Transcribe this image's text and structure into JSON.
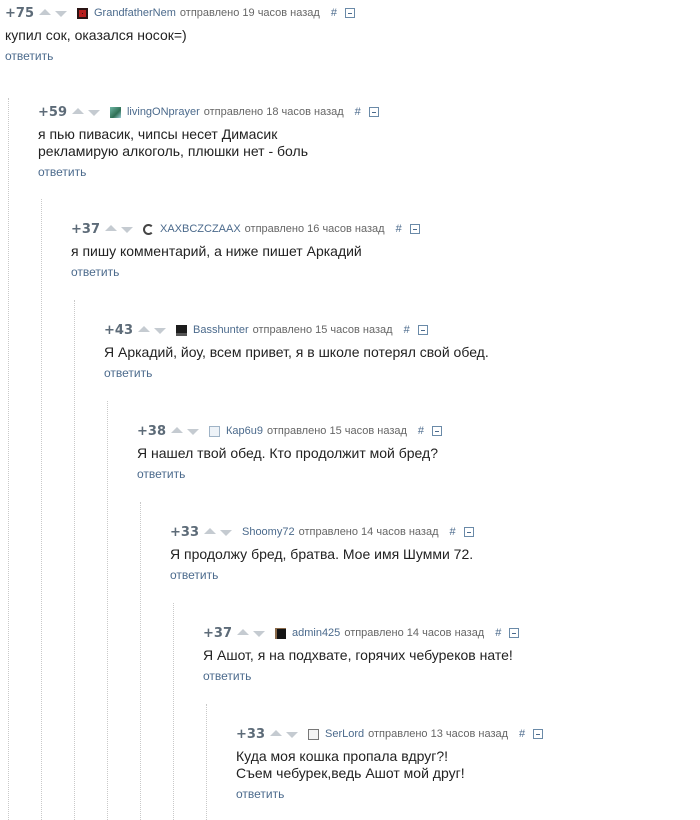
{
  "comments": [
    {
      "score": "+75",
      "author": "GrandfatherNem",
      "time": "отправлено 19 часов назад",
      "hash": "#",
      "text": "купил сок, оказался носок=)",
      "reply": "ответить",
      "avatar": "dark-red-figure-icon"
    },
    {
      "score": "+59",
      "author": "livingONprayer",
      "time": "отправлено 18 часов назад",
      "hash": "#",
      "text": "я пью пивасик, чипсы несет Димасик\nрекламирую алкоголь, плюшки нет - боль",
      "reply": "ответить",
      "avatar": "landscape-photo-icon"
    },
    {
      "score": "+37",
      "author": "XAXBCZCZAAX",
      "time": "отправлено 16 часов назад",
      "hash": "#",
      "text": "я пишу комментарий, а ниже пишет Аркадий",
      "reply": "ответить",
      "avatar": "swirl-icon"
    },
    {
      "score": "+43",
      "author": "Basshunter",
      "time": "отправлено 15 часов назад",
      "hash": "#",
      "text": "Я Аркадий, йоу, всем привет, я в школе потерял свой обед.",
      "reply": "ответить",
      "avatar": "dark-logo-icon"
    },
    {
      "score": "+38",
      "author": "Кар6u9",
      "time": "отправлено 15 часов назад",
      "hash": "#",
      "text": "Я нашел твой обед. Кто продолжит мой бред?",
      "reply": "ответить",
      "avatar": "sketch-icon"
    },
    {
      "score": "+33",
      "author": "Shoomy72",
      "time": "отправлено 14 часов назад",
      "hash": "#",
      "text": "Я продолжу бред, братва. Мое имя Шумми 72.",
      "reply": "ответить",
      "avatar": "blank-icon"
    },
    {
      "score": "+37",
      "author": "admin425",
      "time": "отправлено 14 часов назад",
      "hash": "#",
      "text": "Я Ашот, я на подхвате, горячих чебуреков нате!",
      "reply": "ответить",
      "avatar": "dark-portrait-icon"
    },
    {
      "score": "+33",
      "author": "SerLord",
      "time": "отправлено 13 часов назад",
      "hash": "#",
      "text": "Куда моя кошка пропала вдруг?!\nСъем чебурек,ведь Ашот мой друг!",
      "reply": "ответить",
      "avatar": "framed-picture-icon"
    }
  ]
}
